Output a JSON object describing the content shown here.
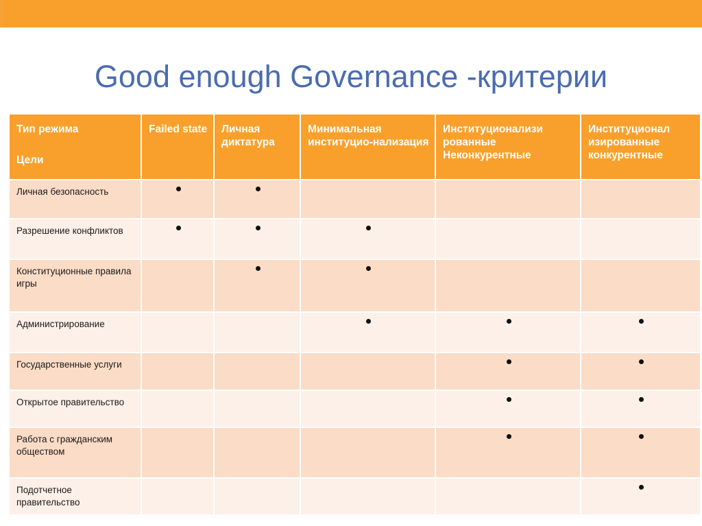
{
  "slide": {
    "title": "Good enough Governance -критерии",
    "accent_color": "#f9a02c",
    "title_color": "#4a6cb0",
    "row_color_a": "#fbdcc6",
    "row_color_b": "#fdf0e8",
    "dot_color": "#111111"
  },
  "table": {
    "corner": {
      "top_label": "Тип режима",
      "bottom_label": "Цели"
    },
    "columns": [
      "Failed state",
      "Личная диктатура",
      "Минимальная институцио-нализация",
      "Институционализи рованные Неконкурентные",
      "Институционал изированные конкурентные"
    ],
    "rows": [
      {
        "label": "Личная безопасность",
        "marks": [
          true,
          true,
          false,
          false,
          false
        ]
      },
      {
        "label": "Разрешение конфликтов",
        "marks": [
          true,
          true,
          true,
          false,
          false
        ]
      },
      {
        "label": "Конституционные правила игры",
        "marks": [
          false,
          true,
          true,
          false,
          false
        ]
      },
      {
        "label": "Администрирование",
        "marks": [
          false,
          false,
          true,
          true,
          true
        ]
      },
      {
        "label": "Государственные услуги",
        "marks": [
          false,
          false,
          false,
          true,
          true
        ]
      },
      {
        "label": "Открытое правительство",
        "marks": [
          false,
          false,
          false,
          true,
          true
        ]
      },
      {
        "label": "Работа с гражданским обществом",
        "marks": [
          false,
          false,
          false,
          true,
          true
        ]
      },
      {
        "label": "Подотчетное правительство",
        "marks": [
          false,
          false,
          false,
          false,
          true
        ]
      }
    ]
  }
}
